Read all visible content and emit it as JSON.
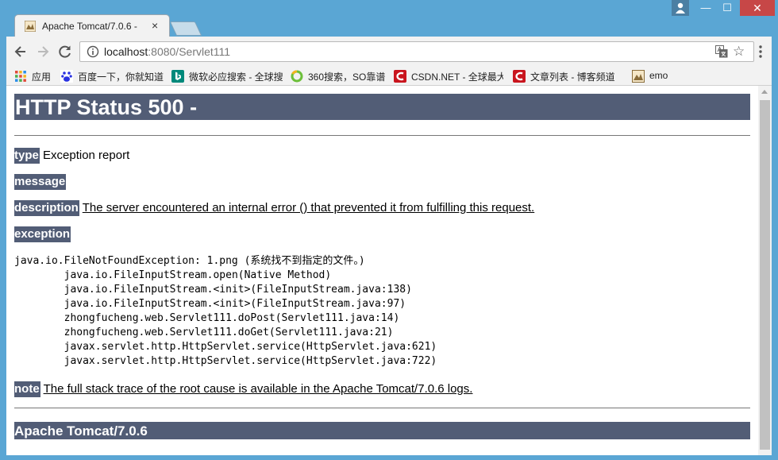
{
  "browser": {
    "tab_title": "Apache Tomcat/7.0.6 -",
    "tab_close": "×",
    "url_host": "localhost",
    "url_rest": ":8080/Servlet111",
    "window_min": "—",
    "window_max": "☐",
    "window_close": "✕"
  },
  "bookmarks": [
    {
      "label": "应用",
      "icon": "apps-grid-icon",
      "color": "#e04a3a"
    },
    {
      "label": "百度一下，你就知道",
      "icon": "baidu-paw-icon",
      "color": "#2932e1"
    },
    {
      "label": "微软必应搜索 - 全球搜",
      "icon": "bing-icon",
      "color": "#00897b"
    },
    {
      "label": "360搜索，SO靠谱",
      "icon": "so360-icon",
      "color": "#6cbf3a"
    },
    {
      "label": "CSDN.NET - 全球最大",
      "icon": "csdn-icon",
      "color": "#c9151e"
    },
    {
      "label": "文章列表 - 博客频道",
      "icon": "csdn-icon",
      "color": "#c9151e"
    },
    {
      "label": "emo",
      "icon": "tomcat-icon",
      "color": "#8a6d3b"
    }
  ],
  "page": {
    "heading": "HTTP Status 500 -",
    "type_label": "type",
    "type_value": "Exception report",
    "message_label": "message",
    "description_label": "description",
    "description_value": "The server encountered an internal error () that prevented it from fulfilling this request.",
    "exception_label": "exception",
    "stack_trace": "java.io.FileNotFoundException: 1.png (系统找不到指定的文件。)\n\tjava.io.FileInputStream.open(Native Method)\n\tjava.io.FileInputStream.<init>(FileInputStream.java:138)\n\tjava.io.FileInputStream.<init>(FileInputStream.java:97)\n\tzhongfucheng.web.Servlet111.doPost(Servlet111.java:14)\n\tzhongfucheng.web.Servlet111.doGet(Servlet111.java:21)\n\tjavax.servlet.http.HttpServlet.service(HttpServlet.java:621)\n\tjavax.servlet.http.HttpServlet.service(HttpServlet.java:722)",
    "note_label": "note",
    "note_value": "The full stack trace of the root cause is available in the Apache Tomcat/7.0.6 logs.",
    "footer": "Apache Tomcat/7.0.6"
  },
  "colors": {
    "tomcat_header": "#525d76",
    "window_frame": "#5aa6d4",
    "close_button": "#c74747"
  }
}
